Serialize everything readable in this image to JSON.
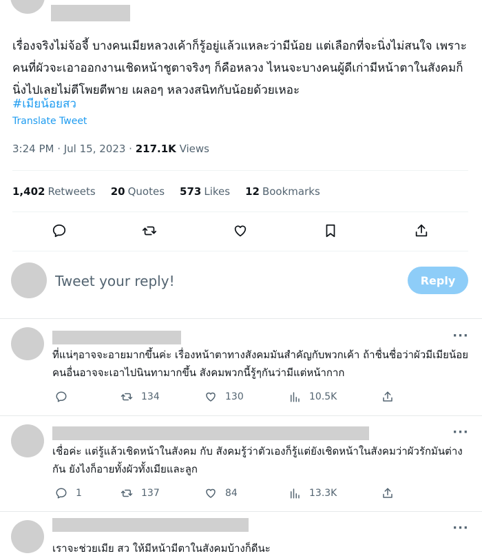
{
  "tweet": {
    "text": "เรื่องจริงไม่จ้อจี้ บางคนเมียหลวงเค้าก็รู้อยู่แล้วแหละว่ามีน้อย แต่เลือกที่จะนิ่งไม่สนใจ เพราะคนที่ผัวจะเอาออกงานเชิดหน้าชูตาจริงๆ ก็คือหลวง ไหนจะบางคนผู้ดีเก่ามีหน้าตาในสังคมก็นิ่งไปเลยไม่ตีโพยตีพาย เผลอๆ หลวงสนิทกับน้อยด้วยเหอะ",
    "hashtag": "#เมียน้อยสว",
    "translate": "Translate Tweet",
    "time": "3:24 PM · Jul 15, 2023 · ",
    "views_count": "217.1K",
    "views_label": " Views"
  },
  "stats": {
    "retweets_count": "1,402",
    "retweets_label": "Retweets",
    "quotes_count": "20",
    "quotes_label": "Quotes",
    "likes_count": "573",
    "likes_label": "Likes",
    "bookmarks_count": "12",
    "bookmarks_label": "Bookmarks"
  },
  "icons": {
    "reply": "reply-icon",
    "retweet": "retweet-icon",
    "like": "heart-icon",
    "bookmark": "bookmark-icon",
    "share": "share-icon",
    "views": "views-icon",
    "more": "more-icon"
  },
  "composer": {
    "placeholder": "Tweet your reply!",
    "button": "Reply"
  },
  "replies": [
    {
      "text": "ที่แน่ๆอาจจะอายมากขึ้นค่ะ เรื่องหน้าตาทางสังคมมันสำคัญกับพวกเค้า ถ้าชื่นชื่อว่าผัวมีเมียน้อย คนอื่นอาจจะเอาไปนินทามากขึ้น สังคมพวกนี้รู้ๆกันว่ามีแต่หน้ากาก",
      "replies": "",
      "retweets": "134",
      "likes": "130",
      "views": "10.5K"
    },
    {
      "text": "เชื่อค่ะ แต่รู้แล้วเชิดหน้าในสังคม กับ สังคมรู้ว่าตัวเองก็รู้แต่ยังเชิดหน้าในสังคมว่าผัวรักมันต่างกัน ยังไงก็อายทั้งผัวทั้งเมียและลูก",
      "replies": "1",
      "retweets": "137",
      "likes": "84",
      "views": "13.3K"
    },
    {
      "text": "เราจะช่วยเมีย สว ให้มีหน้ามีตาในสังคมบ้างก็ดีนะ",
      "replies": "",
      "retweets": "",
      "likes": "",
      "views": ""
    }
  ],
  "colors": {
    "accent": "#1d9bf0",
    "reply_button": "#8ecdf8",
    "secondary_text": "#536471",
    "redaction": "#d0d0d0"
  }
}
